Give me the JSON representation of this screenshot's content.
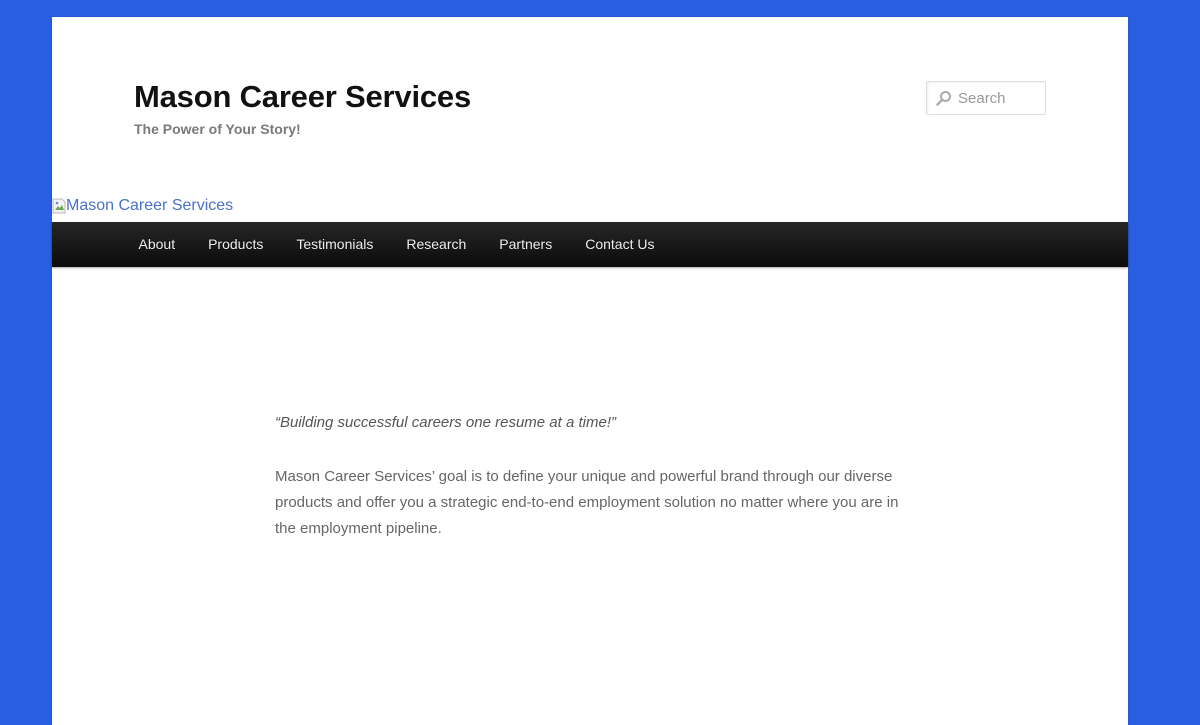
{
  "header": {
    "site_title": "Mason Career Services",
    "site_description": "The Power of Your Story!",
    "header_image_alt": "Mason Career Services"
  },
  "search": {
    "placeholder": "Search",
    "icon": "search-icon"
  },
  "nav": {
    "items": [
      {
        "label": "About"
      },
      {
        "label": "Products"
      },
      {
        "label": "Testimonials"
      },
      {
        "label": "Research"
      },
      {
        "label": "Partners"
      },
      {
        "label": "Contact Us"
      }
    ]
  },
  "content": {
    "tagline": "“Building successful careers one resume at a time!”",
    "intro": "Mason Career Services’ goal is to define your unique and powerful brand through our diverse products and offer you a strategic end-to-end employment solution no matter where you are in the employment pipeline."
  },
  "colors": {
    "background": "#2a5ee0",
    "page": "#ffffff",
    "nav_bar": "#1a1a1a",
    "link": "#4a72c4"
  }
}
